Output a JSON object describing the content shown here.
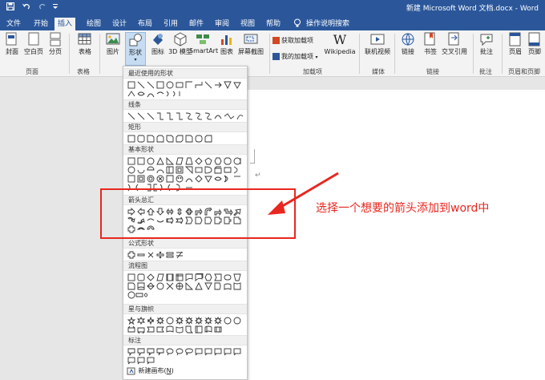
{
  "title_bar": {
    "document_title": "新建 Microsoft Word 文档.docx  -  Word",
    "quick_access": [
      "save-icon",
      "undo-icon",
      "redo-icon",
      "customize-icon"
    ]
  },
  "tabs": [
    {
      "label": "文件"
    },
    {
      "label": "开始"
    },
    {
      "label": "插入",
      "active": true
    },
    {
      "label": "绘图"
    },
    {
      "label": "设计"
    },
    {
      "label": "布局"
    },
    {
      "label": "引用"
    },
    {
      "label": "邮件"
    },
    {
      "label": "审阅"
    },
    {
      "label": "视图"
    },
    {
      "label": "帮助"
    },
    {
      "label": "操作说明搜索"
    }
  ],
  "ribbon": {
    "pages_group": {
      "cover": "封面",
      "blank": "空白页",
      "break": "分页",
      "label": "页面"
    },
    "tables_group": {
      "table": "表格",
      "label": "表格"
    },
    "illustrations_group": {
      "picture": "图片",
      "shapes": "形状",
      "icons": "图标",
      "models_3d": "3D 模型",
      "smartart": "SmartArt",
      "chart": "图表",
      "screenshot": "屏幕截图"
    },
    "addins_group": {
      "get_addins": "获取加载项",
      "my_addins": "我的加载项",
      "wikipedia": "Wikipedia",
      "label": "加载项"
    },
    "media_group": {
      "online_video": "联机视频",
      "label": "媒体"
    },
    "links_group": {
      "link": "链接",
      "bookmark": "书签",
      "cross_ref": "交叉引用",
      "label": "链接"
    },
    "comments_group": {
      "comment": "批注",
      "label": "批注"
    },
    "header_footer_group": {
      "header": "页眉",
      "footer": "页脚",
      "label": "页眉和页脚"
    }
  },
  "shapes_menu": {
    "sections": [
      {
        "title": "最近使用的形状"
      },
      {
        "title": "线条"
      },
      {
        "title": "矩形"
      },
      {
        "title": "基本形状"
      },
      {
        "title": "箭头总汇"
      },
      {
        "title": "公式形状"
      },
      {
        "title": "流程图"
      },
      {
        "title": "星与旗帜"
      },
      {
        "title": "标注"
      }
    ],
    "new_canvas": "新建画布",
    "new_canvas_key": "N"
  },
  "annotation": {
    "text": "选择一个想要的箭头添加到word中",
    "color": "#e8271f"
  },
  "colors": {
    "brand": "#2b579a",
    "ribbon_bg": "#f3f3f3",
    "selected_button": "#c5dcf2"
  }
}
